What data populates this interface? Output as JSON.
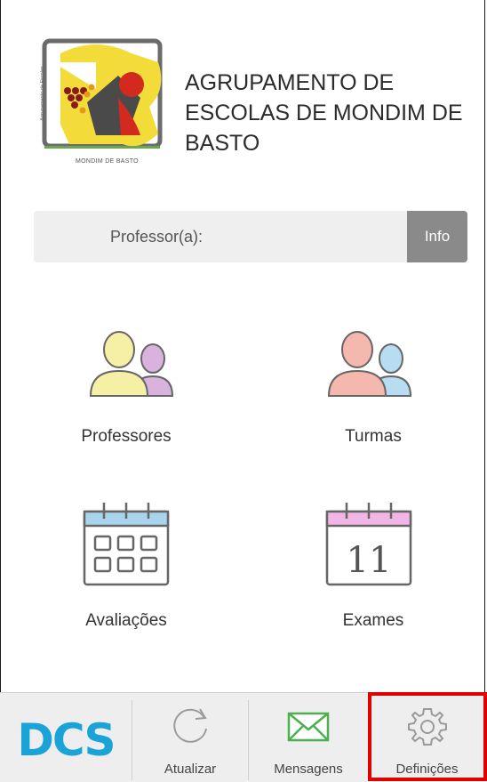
{
  "header": {
    "school_name": "AGRUPAMENTO DE ESCOLAS DE MONDIM DE BASTO",
    "logo_caption": "MONDIM DE BASTO",
    "logo_side_text": "Agrupamento de Escolas"
  },
  "role": {
    "label": "Professor(a):",
    "info_label": "Info"
  },
  "tiles": [
    {
      "label": "Professores",
      "icon": "users-icon"
    },
    {
      "label": "Turmas",
      "icon": "users-icon"
    },
    {
      "label": "Avaliações",
      "icon": "calendar-grid-icon"
    },
    {
      "label": "Exames",
      "icon": "calendar-day-icon",
      "day": "11"
    }
  ],
  "bottom_nav": {
    "brand": "DCS",
    "items": [
      {
        "label": "Atualizar",
        "icon": "refresh-icon"
      },
      {
        "label": "Mensagens",
        "icon": "mail-icon"
      },
      {
        "label": "Definições",
        "icon": "gear-icon"
      }
    ]
  },
  "colors": {
    "highlight": "#e00000",
    "info_button": "#8a8a8a",
    "mail_icon": "#4caf50"
  }
}
